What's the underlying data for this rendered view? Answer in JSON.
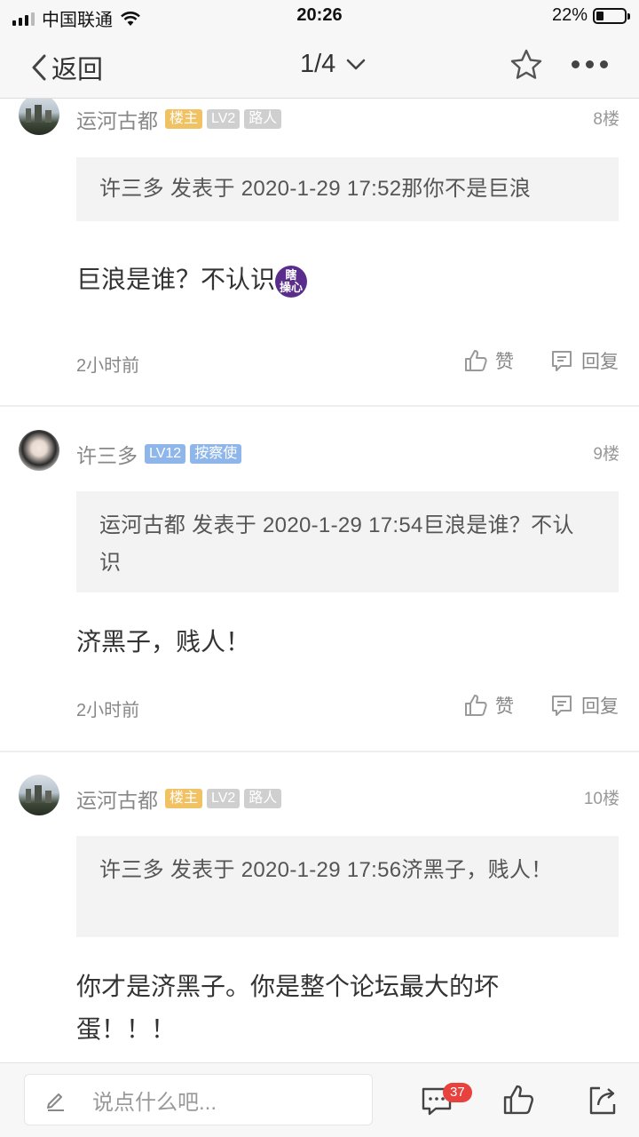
{
  "status_bar": {
    "carrier": "中国联通",
    "time": "20:26",
    "battery": "22%",
    "battery_level": 0.22
  },
  "nav": {
    "back_label": "返回",
    "page_indicator": "1/4"
  },
  "posts": [
    {
      "author": "运河古都",
      "badges": [
        "楼主",
        "LV2",
        "路人"
      ],
      "floor": "8楼",
      "quote": "许三多 发表于 2020-1-29 17:52那你不是巨浪",
      "body": "巨浪是谁？不认识",
      "emoji_text": "瞎操心",
      "time": "2小时前",
      "like_label": "赞",
      "reply_label": "回复"
    },
    {
      "author": "许三多",
      "badges": [
        "LV12",
        "按察使"
      ],
      "floor": "9楼",
      "quote": "运河古都 发表于 2020-1-29 17:54巨浪是谁？不认识",
      "body": "济黑子，贱人！",
      "time": "2小时前",
      "like_label": "赞",
      "reply_label": "回复"
    },
    {
      "author": "运河古都",
      "badges": [
        "楼主",
        "LV2",
        "路人"
      ],
      "floor": "10楼",
      "quote": "许三多 发表于 2020-1-29 17:56济黑子，贱人！",
      "body": "你才是济黑子。你是整个论坛最大的坏蛋！！！"
    }
  ],
  "bottom_bar": {
    "comment_placeholder": "说点什么吧...",
    "comment_count": "37"
  },
  "colors": {
    "badge_owner": "#f0c263",
    "badge_level_gray": "#cfcfcf",
    "badge_level_blue": "#8fb6ea",
    "badge_count": "#e8423f",
    "emoji_purple": "#5a2d8c"
  }
}
